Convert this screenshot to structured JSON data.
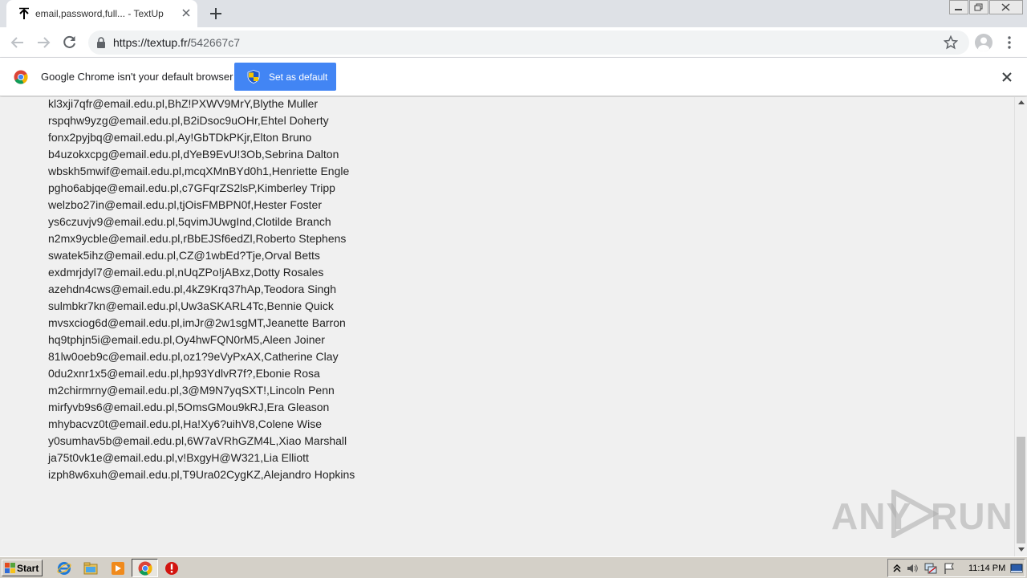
{
  "browser": {
    "tab_title": "email,password,full... - TextUp",
    "url_host": "https://textup.fr/",
    "url_path": "542667c7"
  },
  "infobar": {
    "message": "Google Chrome isn't your default browser",
    "button_label": "Set as default"
  },
  "content": {
    "lines": [
      "kl3xji7qfr@email.edu.pl,BhZ!PXWV9MrY,Blythe Muller",
      "rspqhw9yzg@email.edu.pl,B2iDsoc9uOHr,Ehtel Doherty",
      "fonx2pyjbq@email.edu.pl,Ay!GbTDkPKjr,Elton Bruno",
      "b4uzokxcpg@email.edu.pl,dYeB9EvU!3Ob,Sebrina Dalton",
      "wbskh5mwif@email.edu.pl,mcqXMnBYd0h1,Henriette Engle",
      "pgho6abjqe@email.edu.pl,c7GFqrZS2lsP,Kimberley Tripp",
      "welzbo27in@email.edu.pl,tjOisFMBPN0f,Hester Foster",
      "ys6czuvjv9@email.edu.pl,5qvimJUwgInd,Clotilde Branch",
      "n2mx9ycble@email.edu.pl,rBbEJSf6edZl,Roberto Stephens",
      "swatek5ihz@email.edu.pl,CZ@1wbEd?Tje,Orval Betts",
      "exdmrjdyl7@email.edu.pl,nUqZPo!jABxz,Dotty Rosales",
      "azehdn4cws@email.edu.pl,4kZ9Krq37hAp,Teodora Singh",
      "sulmbkr7kn@email.edu.pl,Uw3aSKARL4Tc,Bennie Quick",
      "mvsxciog6d@email.edu.pl,imJr@2w1sgMT,Jeanette Barron",
      "hq9tphjn5i@email.edu.pl,Oy4hwFQN0rM5,Aleen Joiner",
      "81lw0oeb9c@email.edu.pl,oz1?9eVyPxAX,Catherine Clay",
      "0du2xnr1x5@email.edu.pl,hp93YdlvR7f?,Ebonie Rosa",
      "m2chirmrny@email.edu.pl,3@M9N7yqSXT!,Lincoln Penn",
      "mirfyvb9s6@email.edu.pl,5OmsGMou9kRJ,Era Gleason",
      "mhybacvz0t@email.edu.pl,Ha!Xy6?uihV8,Colene Wise",
      "y0sumhav5b@email.edu.pl,6W7aVRhGZM4L,Xiao Marshall",
      "ja75t0vk1e@email.edu.pl,v!BxgyH@W321,Lia Elliott",
      "izph8w6xuh@email.edu.pl,T9Ura02CygKZ,Alejandro Hopkins"
    ]
  },
  "watermark": {
    "left": "ANY",
    "right": "RUN"
  },
  "taskbar": {
    "start_label": "Start",
    "clock": "11:14 PM"
  },
  "colors": {
    "accent": "#4285f4",
    "tabstrip": "#dee1e6",
    "page_bg": "#f0f0f0",
    "taskbar": "#d4d0c8"
  },
  "icons": [
    "upload-arrow-icon",
    "close-icon",
    "plus-icon",
    "back-icon",
    "forward-icon",
    "reload-icon",
    "lock-icon",
    "star-icon",
    "profile-icon",
    "menu-icon",
    "chrome-logo-icon",
    "shield-icon",
    "windows-flag-icon",
    "ie-icon",
    "folder-icon",
    "media-player-icon",
    "chrome-icon",
    "stop-icon"
  ]
}
